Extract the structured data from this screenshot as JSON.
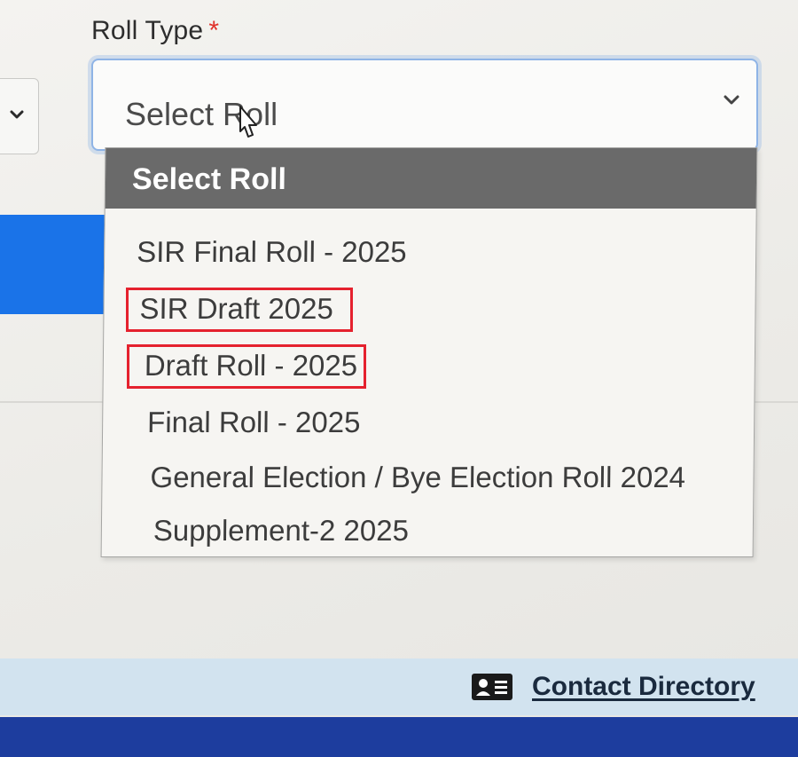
{
  "field": {
    "label": "Roll Type",
    "required_marker": "*"
  },
  "roll_select": {
    "value": "Select Roll",
    "icon": "chevron-down-icon"
  },
  "dropdown": {
    "header": "Select Roll",
    "options": [
      "SIR Final Roll - 2025",
      "SIR Draft 2025",
      "Draft Roll - 2025",
      "Final Roll - 2025",
      "General Election / Bye Election Roll 2024",
      "Supplement-2 2025"
    ],
    "highlighted_options": [
      "SIR Draft 2025",
      "Draft Roll - 2025"
    ]
  },
  "footer": {
    "contact_label": "Contact Directory",
    "contact_icon": "contact-card-icon"
  },
  "colors": {
    "accent_blue": "#1a73e8",
    "highlight_red": "#e5212e",
    "dropdown_header": "#6a6a6a",
    "footer_band": "#d2e3ef",
    "bottom_bar": "#1d3d9e"
  }
}
